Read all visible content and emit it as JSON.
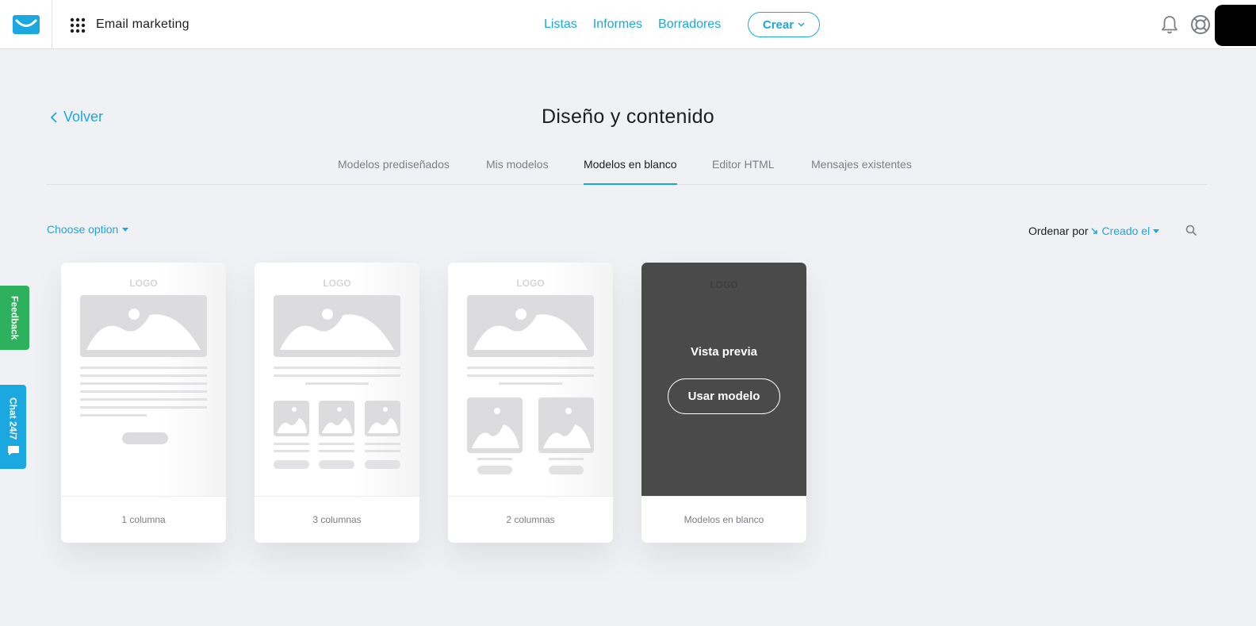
{
  "header": {
    "app_name": "Email marketing",
    "nav": [
      "Listas",
      "Informes",
      "Borradores"
    ],
    "create_label": "Crear"
  },
  "page": {
    "back_label": "Volver",
    "title": "Diseño y contenido",
    "tabs": [
      "Modelos prediseñados",
      "Mis modelos",
      "Modelos en blanco",
      "Editor HTML",
      "Mensajes existentes"
    ],
    "active_tab": "Modelos en blanco"
  },
  "toolbar": {
    "filter_label": "Choose option",
    "sort_label": "Ordenar por",
    "sort_value": "Creado el"
  },
  "templates": [
    {
      "caption": "1 columna",
      "logo": "LOGO"
    },
    {
      "caption": "3 columnas",
      "logo": "LOGO"
    },
    {
      "caption": "2 columnas",
      "logo": "LOGO"
    },
    {
      "caption": "Modelos en blanco",
      "logo": "LOGO",
      "preview_label": "Vista previa",
      "use_label": "Usar modelo"
    }
  ],
  "side_tabs": {
    "feedback": "Feedback",
    "chat": "Chat 24/7"
  },
  "colors": {
    "accent": "#1ba8e0",
    "feedback": "#2eb15c",
    "overlay": "#4a4a4a"
  }
}
